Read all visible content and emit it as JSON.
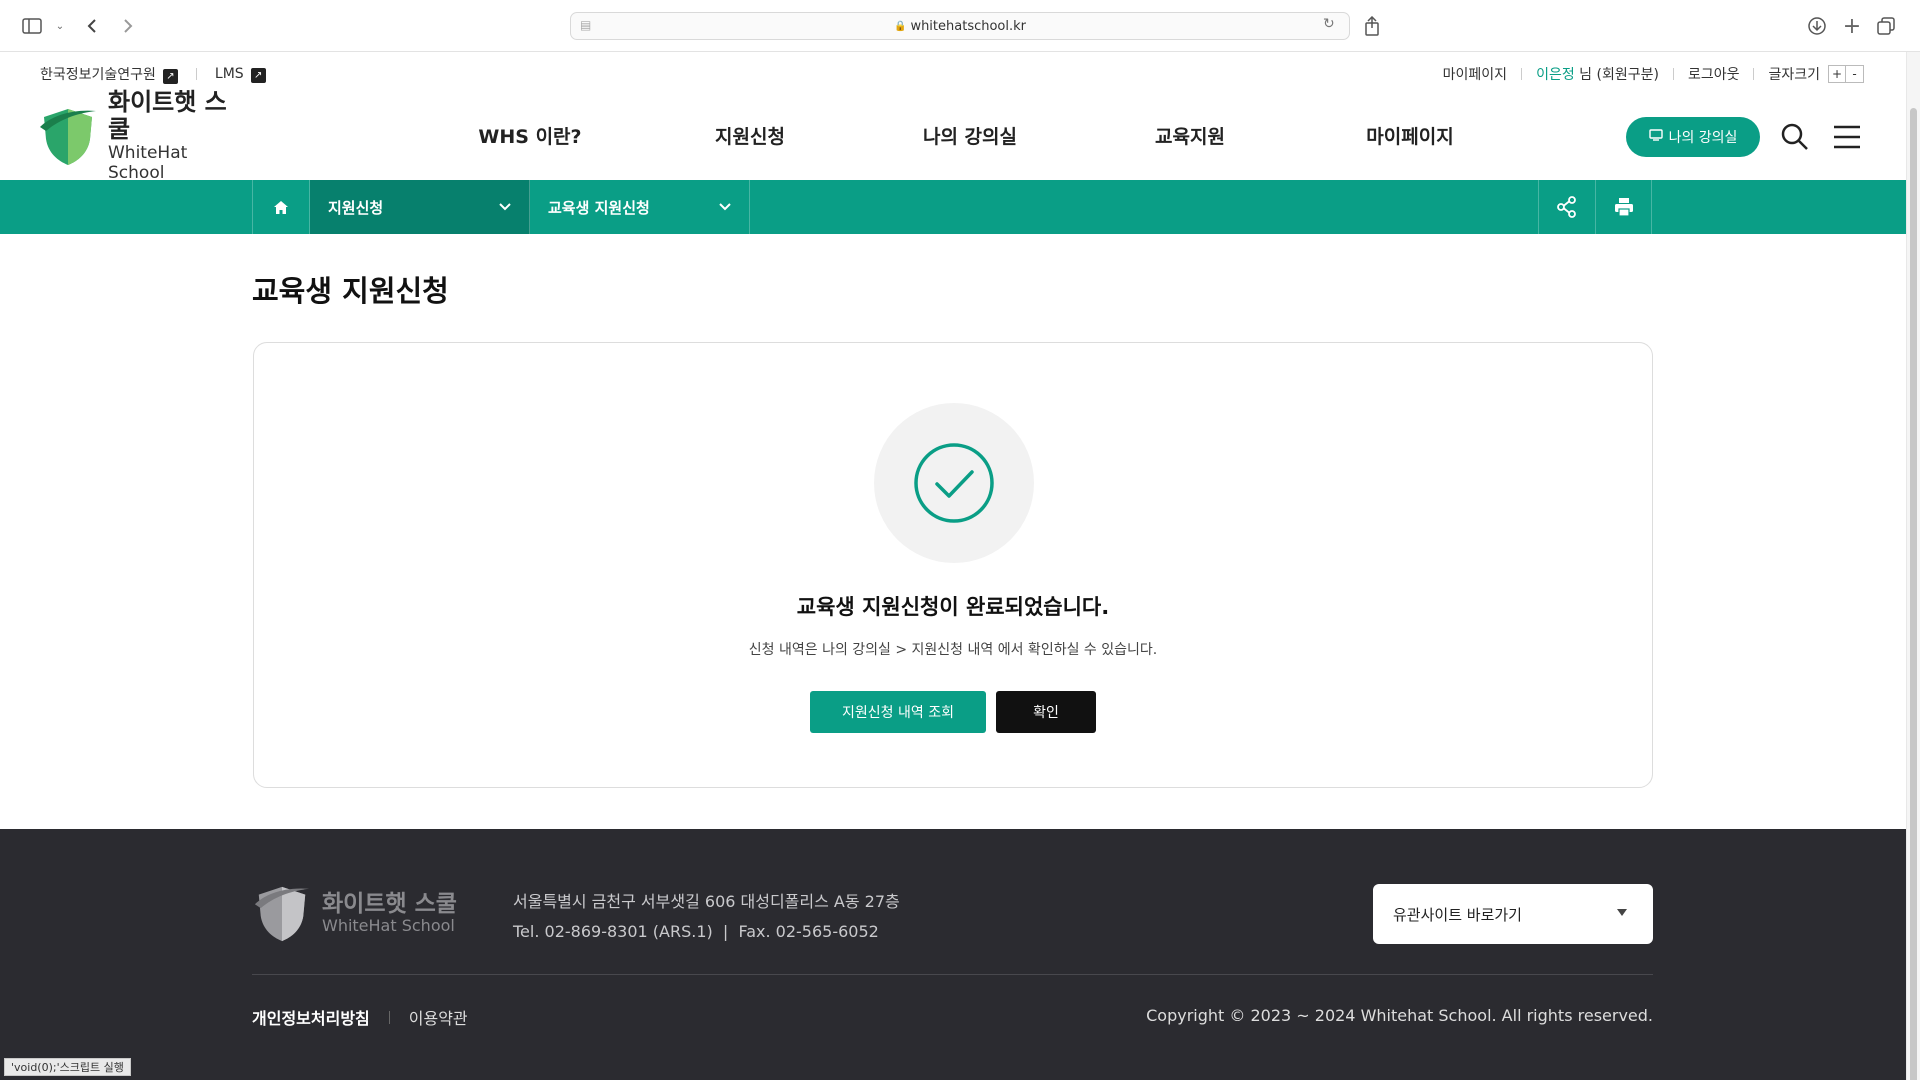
{
  "browser": {
    "url": "whitehatschool.kr"
  },
  "util": {
    "kisia": "한국정보기술연구원",
    "lms": "LMS",
    "mypage": "마이페이지",
    "user_name": "이은정",
    "user_suffix": " 님 (회원구분)",
    "logout": "로그아웃",
    "font_size": "글자크기",
    "font_plus": "+",
    "font_minus": "-"
  },
  "header": {
    "logo_kor": "화이트햇 스쿨",
    "logo_eng": "WhiteHat School",
    "nav": [
      "WHS 이란?",
      "지원신청",
      "나의 강의실",
      "교육지원",
      "마이페이지"
    ],
    "my_class": "나의 강의실"
  },
  "subnav": {
    "crumb1": "지원신청",
    "crumb2": "교육생 지원신청"
  },
  "main": {
    "page_title": "교육생 지원신청",
    "done_title": "교육생 지원신청이 완료되었습니다.",
    "done_desc": "신청 내역은 나의 강의실 > 지원신청 내역 에서 확인하실 수 있습니다.",
    "btn_history": "지원신청 내역 조회",
    "btn_confirm": "확인"
  },
  "footer": {
    "logo_kor": "화이트햇 스쿨",
    "logo_eng": "WhiteHat School",
    "address": "서울특별시 금천구 서부샛길 606 대성디폴리스 A동 27층",
    "contact": "Tel. 02-869-8301 (ARS.1)  |  Fax. 02-565-6052",
    "related_sites": "유관사이트 바로가기",
    "privacy": "개인정보처리방침",
    "terms": "이용약관",
    "copyright": "Copyright © 2023 ~ 2024 Whitehat School. All rights reserved."
  },
  "status_bar": "'void(0);'스크립트 실행",
  "colors": {
    "accent": "#0a9e86",
    "accent_dark": "#07806d",
    "footer_bg": "#2b2b30"
  }
}
